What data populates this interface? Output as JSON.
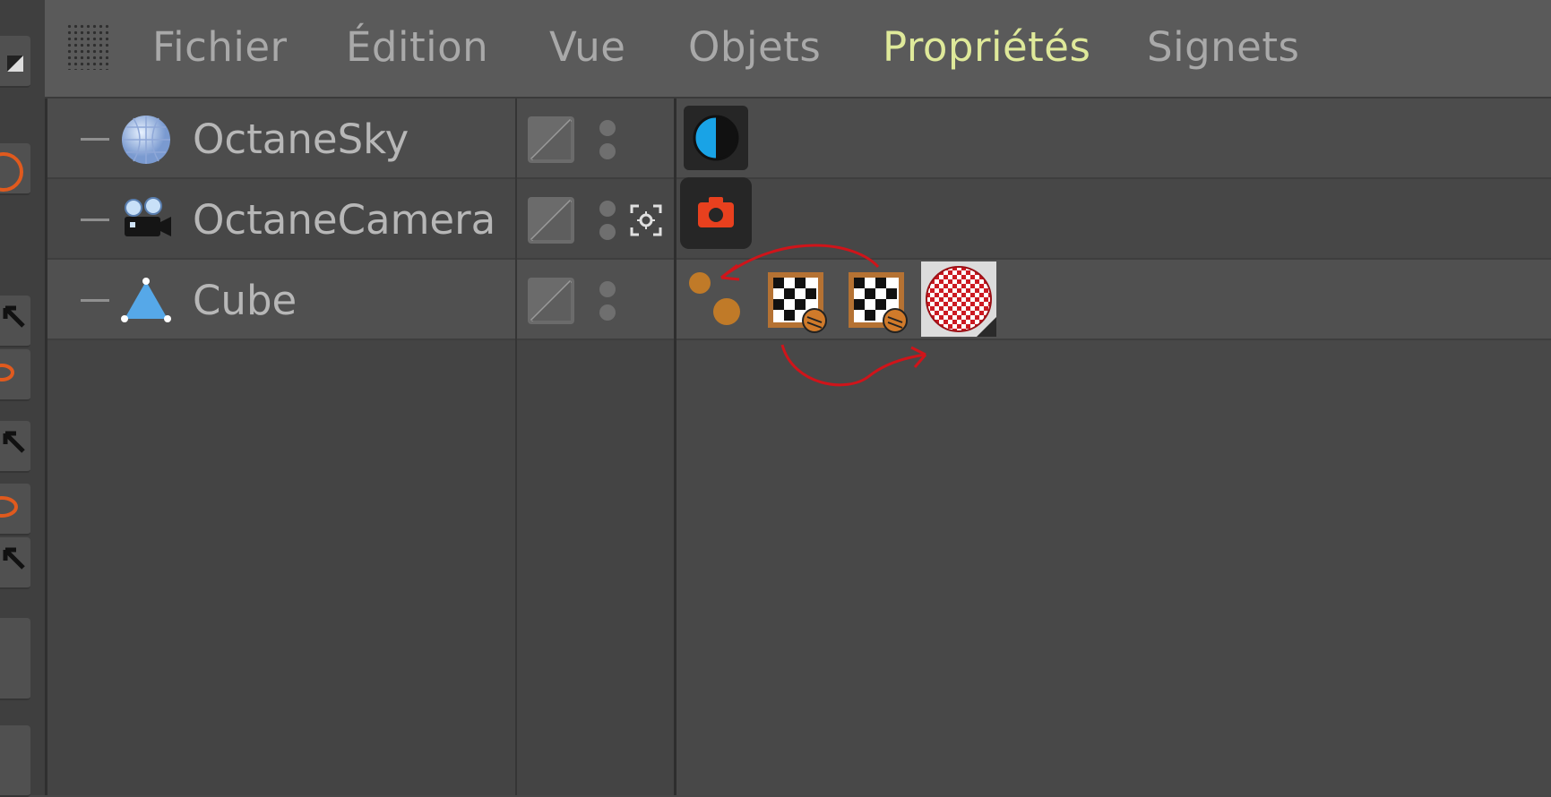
{
  "menu": {
    "items": [
      "Fichier",
      "Édition",
      "Vue",
      "Objets",
      "Propriétés",
      "Signets"
    ],
    "active": "Propriétés"
  },
  "objects": [
    {
      "name": "OctaneSky",
      "icon": "sky-sphere-icon",
      "tags": [
        "octane-environment-tag-icon"
      ]
    },
    {
      "name": "OctaneCamera",
      "icon": "camera-object-icon",
      "tags": [
        "octane-camera-tag-icon"
      ]
    },
    {
      "name": "Cube",
      "icon": "primitive-object-icon",
      "tags": [
        "octane-object-tag-icon",
        "texture-tag-icon",
        "texture-tag-icon",
        "material-tag-icon"
      ]
    }
  ],
  "colors": {
    "menu_active": "#dfe99a",
    "annotation": "#d0141a",
    "camera_tag": "#e8401e",
    "env_tag": "#19a3e6"
  }
}
